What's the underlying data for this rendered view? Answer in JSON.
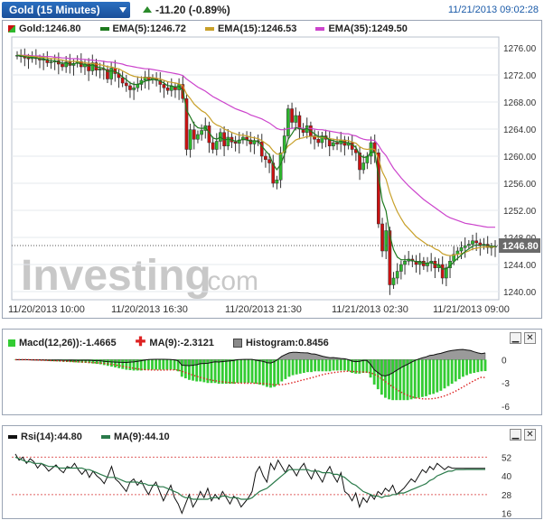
{
  "header": {
    "title": "Gold (15 Minutes)",
    "change": "-11.20 (-0.89%)",
    "timestamp": "11/21/2013 09:02:28"
  },
  "main_legend": {
    "gold": "Gold:1246.80",
    "ema5": "EMA(5):1246.72",
    "ema15": "EMA(15):1246.53",
    "ema35": "EMA(35):1249.50"
  },
  "macd_legend": {
    "macd": "Macd(12,26)):-1.4665",
    "ma9": "MA(9):-2.3121",
    "hist": "Histogram:0.8456"
  },
  "rsi_legend": {
    "rsi": "Rsi(14):44.80",
    "ma9": "MA(9):44.10"
  },
  "watermark": {
    "main": "Investing",
    "suffix": ".com"
  },
  "colors": {
    "candle_up": "#2eb82e",
    "candle_down": "#cc1111",
    "ema5": "#1e7a1e",
    "ema15": "#c8a02a",
    "ema35": "#cc44cc",
    "macd_hist": "#33cc33",
    "macd_line": "#111111",
    "macd_ma": "#dd2222",
    "rsi_line": "#111111",
    "rsi_ma": "#2a7a4a",
    "price_box": "#6a6a6a"
  },
  "chart_data": [
    {
      "type": "candlestick",
      "title": "Gold (15 Minutes)",
      "y_ticks": [
        "1276.00",
        "1272.00",
        "1268.00",
        "1264.00",
        "1260.00",
        "1256.00",
        "1252.00",
        "1248.00",
        "1244.00",
        "1240.00"
      ],
      "ylim": [
        1238.8,
        1277.6
      ],
      "x_ticks": [
        "11/20/2013 10:00",
        "11/20/2013 16:30",
        "11/20/2013 21:30",
        "11/21/2013 02:30",
        "11/21/2013 09:00"
      ],
      "last_price_label": "1246.80",
      "last_price": 1246.8,
      "close": [
        1274.9,
        1274.7,
        1274.5,
        1274.4,
        1274.6,
        1274.4,
        1274.2,
        1274.3,
        1273.8,
        1273.9,
        1274.1,
        1273.6,
        1273.2,
        1273.9,
        1273.4,
        1273.7,
        1274.0,
        1273.2,
        1273.6,
        1272.6,
        1273.8,
        1272.7,
        1272.9,
        1272.8,
        1271.4,
        1273.0,
        1272.2,
        1271.6,
        1270.8,
        1270.4,
        1269.8,
        1270.1,
        1270.6,
        1271.2,
        1271.7,
        1271.3,
        1271.5,
        1271.2,
        1270.6,
        1270.1,
        1269.7,
        1270.3,
        1269.8,
        1270.6,
        1268.5,
        1261.0,
        1263.9,
        1262.5,
        1263.2,
        1263.8,
        1264.5,
        1262.0,
        1261.0,
        1262.2,
        1263.5,
        1261.5,
        1262.8,
        1262.1,
        1261.9,
        1262.4,
        1262.8,
        1262.4,
        1261.8,
        1262.3,
        1262.1,
        1260.0,
        1259.5,
        1259.0,
        1256.0,
        1256.5,
        1260.5,
        1263.0,
        1267.0,
        1265.0,
        1266.0,
        1264.0,
        1263.5,
        1264.5,
        1263.0,
        1262.5,
        1262.0,
        1263.0,
        1262.5,
        1261.5,
        1262.0,
        1261.8,
        1262.4,
        1261.6,
        1262.0,
        1261.0,
        1260.5,
        1258.0,
        1259.0,
        1260.0,
        1262.0,
        1260.5,
        1250.0,
        1246.0,
        1249.0,
        1241.0,
        1242.0,
        1243.0,
        1244.0,
        1244.5,
        1244.8,
        1244.5,
        1244.0,
        1244.5,
        1243.8,
        1244.2,
        1244.5,
        1243.5,
        1244.0,
        1242.0,
        1243.5,
        1244.5,
        1245.5,
        1246.0,
        1246.5,
        1246.8,
        1247.0,
        1247.5,
        1247.2,
        1246.8,
        1247.0,
        1246.5,
        1246.6,
        1246.7
      ],
      "ema5": [
        1274.9,
        1274.8,
        1274.7,
        1274.6,
        1274.6,
        1274.5,
        1274.4,
        1274.4,
        1274.2,
        1274.1,
        1274.1,
        1273.9,
        1273.7,
        1273.8,
        1273.6,
        1273.6,
        1273.8,
        1273.6,
        1273.6,
        1273.3,
        1273.5,
        1273.2,
        1273.1,
        1273.0,
        1272.5,
        1272.6,
        1272.5,
        1272.2,
        1271.7,
        1271.3,
        1270.8,
        1270.6,
        1270.6,
        1270.8,
        1271.1,
        1271.2,
        1271.3,
        1271.3,
        1271.1,
        1270.8,
        1270.4,
        1270.4,
        1270.2,
        1270.3,
        1269.7,
        1266.8,
        1265.8,
        1264.7,
        1264.2,
        1264.1,
        1264.2,
        1263.5,
        1262.7,
        1262.5,
        1262.8,
        1262.4,
        1262.5,
        1262.4,
        1262.2,
        1262.3,
        1262.5,
        1262.4,
        1262.2,
        1262.3,
        1262.2,
        1261.5,
        1260.8,
        1260.2,
        1258.8,
        1258.0,
        1258.8,
        1260.2,
        1262.5,
        1263.3,
        1264.2,
        1264.1,
        1263.9,
        1264.1,
        1263.7,
        1263.3,
        1262.9,
        1262.9,
        1262.8,
        1262.4,
        1262.3,
        1262.1,
        1262.2,
        1262.0,
        1262.0,
        1261.7,
        1261.3,
        1260.2,
        1259.8,
        1259.9,
        1260.6,
        1260.6,
        1257.0,
        1253.4,
        1251.9,
        1248.3,
        1246.2,
        1245.1,
        1244.7,
        1244.7,
        1244.7,
        1244.6,
        1244.4,
        1244.4,
        1244.2,
        1244.2,
        1244.3,
        1244.0,
        1244.0,
        1243.3,
        1243.4,
        1243.8,
        1244.4,
        1244.9,
        1245.4,
        1245.9,
        1246.3,
        1246.7,
        1246.9,
        1246.8,
        1246.9,
        1246.8,
        1246.7,
        1246.7
      ],
      "ema15": [
        1274.9,
        1274.9,
        1274.8,
        1274.8,
        1274.7,
        1274.7,
        1274.6,
        1274.6,
        1274.5,
        1274.4,
        1274.4,
        1274.3,
        1274.2,
        1274.1,
        1274.0,
        1274.0,
        1274.0,
        1273.9,
        1273.8,
        1273.7,
        1273.7,
        1273.6,
        1273.5,
        1273.4,
        1273.2,
        1273.2,
        1273.0,
        1272.9,
        1272.6,
        1272.3,
        1272.0,
        1271.8,
        1271.7,
        1271.6,
        1271.6,
        1271.6,
        1271.6,
        1271.5,
        1271.4,
        1271.2,
        1271.0,
        1270.9,
        1270.8,
        1270.7,
        1270.4,
        1269.2,
        1268.5,
        1267.7,
        1267.2,
        1266.7,
        1266.4,
        1265.8,
        1265.0,
        1264.6,
        1264.4,
        1264.0,
        1263.8,
        1263.5,
        1263.3,
        1263.1,
        1263.1,
        1263.0,
        1262.8,
        1262.7,
        1262.6,
        1262.3,
        1261.9,
        1261.5,
        1260.8,
        1260.3,
        1260.3,
        1260.7,
        1261.5,
        1261.9,
        1262.4,
        1262.6,
        1262.7,
        1262.9,
        1262.9,
        1262.9,
        1262.8,
        1262.8,
        1262.7,
        1262.6,
        1262.5,
        1262.4,
        1262.4,
        1262.3,
        1262.3,
        1262.1,
        1261.9,
        1261.4,
        1261.1,
        1261.0,
        1261.1,
        1261.0,
        1259.6,
        1257.7,
        1256.6,
        1254.6,
        1253.1,
        1251.8,
        1250.8,
        1249.9,
        1249.3,
        1248.7,
        1248.1,
        1247.7,
        1247.3,
        1246.9,
        1246.7,
        1246.3,
        1246.1,
        1245.6,
        1245.4,
        1245.3,
        1245.4,
        1245.5,
        1245.6,
        1245.8,
        1246.0,
        1246.3,
        1246.4,
        1246.5,
        1246.6,
        1246.6,
        1246.6,
        1246.6
      ],
      "ema35": [
        1274.9,
        1274.9,
        1274.9,
        1274.9,
        1274.8,
        1274.8,
        1274.8,
        1274.7,
        1274.7,
        1274.7,
        1274.6,
        1274.6,
        1274.5,
        1274.5,
        1274.4,
        1274.4,
        1274.4,
        1274.3,
        1274.3,
        1274.2,
        1274.2,
        1274.1,
        1274.1,
        1274.0,
        1273.9,
        1273.9,
        1273.8,
        1273.7,
        1273.6,
        1273.4,
        1273.3,
        1273.2,
        1273.1,
        1273.0,
        1272.9,
        1272.9,
        1272.8,
        1272.7,
        1272.6,
        1272.5,
        1272.4,
        1272.3,
        1272.2,
        1272.1,
        1271.9,
        1271.4,
        1271.0,
        1270.6,
        1270.2,
        1269.9,
        1269.6,
        1269.2,
        1268.8,
        1268.5,
        1268.2,
        1267.9,
        1267.6,
        1267.3,
        1267.0,
        1266.8,
        1266.6,
        1266.4,
        1266.1,
        1265.9,
        1265.7,
        1265.5,
        1265.2,
        1264.9,
        1264.5,
        1264.1,
        1263.9,
        1263.9,
        1264.1,
        1264.1,
        1264.2,
        1264.2,
        1264.1,
        1264.1,
        1264.1,
        1264.0,
        1263.9,
        1263.9,
        1263.8,
        1263.7,
        1263.6,
        1263.5,
        1263.4,
        1263.3,
        1263.3,
        1263.1,
        1263.0,
        1262.7,
        1262.5,
        1262.4,
        1262.4,
        1262.3,
        1261.6,
        1260.7,
        1260.1,
        1259.1,
        1258.2,
        1257.5,
        1256.8,
        1256.2,
        1255.6,
        1255.1,
        1254.6,
        1254.1,
        1253.6,
        1253.2,
        1252.8,
        1252.4,
        1252.0,
        1251.6,
        1251.2,
        1250.9,
        1250.7,
        1250.5,
        1250.3,
        1250.1,
        1250.0,
        1249.9,
        1249.8,
        1249.7,
        1249.6,
        1249.5,
        1249.5,
        1249.5
      ]
    },
    {
      "type": "bar",
      "title": "Macd(12,26)",
      "y_ticks": [
        "0",
        "-3",
        "-6"
      ],
      "ylim": [
        -6.8,
        1.2
      ],
      "macd": [
        0.0,
        0.0,
        0.0,
        -0.02,
        -0.05,
        -0.08,
        -0.1,
        -0.12,
        -0.15,
        -0.18,
        -0.2,
        -0.22,
        -0.25,
        -0.28,
        -0.3,
        -0.32,
        -0.35,
        -0.38,
        -0.4,
        -0.42,
        -0.45,
        -0.5,
        -0.55,
        -0.6,
        -0.7,
        -0.8,
        -0.9,
        -1.0,
        -1.1,
        -1.2,
        -1.3,
        -1.35,
        -1.4,
        -1.4,
        -1.4,
        -1.35,
        -1.3,
        -1.3,
        -1.3,
        -1.3,
        -1.3,
        -1.3,
        -1.3,
        -1.35,
        -1.5,
        -2.2,
        -2.4,
        -2.6,
        -2.7,
        -2.8,
        -2.8,
        -2.9,
        -3.0,
        -3.0,
        -3.0,
        -3.1,
        -3.1,
        -3.1,
        -3.1,
        -3.1,
        -3.0,
        -3.0,
        -3.0,
        -3.0,
        -3.0,
        -3.1,
        -3.2,
        -3.3,
        -3.5,
        -3.6,
        -3.5,
        -3.2,
        -2.8,
        -2.5,
        -2.2,
        -2.0,
        -1.9,
        -1.8,
        -1.7,
        -1.6,
        -1.6,
        -1.5,
        -1.5,
        -1.5,
        -1.5,
        -1.5,
        -1.4,
        -1.4,
        -1.4,
        -1.4,
        -1.5,
        -1.7,
        -1.8,
        -1.8,
        -1.7,
        -1.7,
        -2.3,
        -3.2,
        -3.8,
        -4.5,
        -4.9,
        -5.1,
        -5.2,
        -5.2,
        -5.2,
        -5.2,
        -5.2,
        -5.1,
        -5.0,
        -4.9,
        -4.8,
        -4.7,
        -4.5,
        -4.4,
        -4.2,
        -4.0,
        -3.7,
        -3.4,
        -3.1,
        -2.8,
        -2.5,
        -2.2,
        -2.0,
        -1.8,
        -1.7,
        -1.6,
        -1.5,
        -1.47
      ],
      "ma9": [
        0.0,
        0.0,
        0.0,
        -0.01,
        -0.02,
        -0.03,
        -0.05,
        -0.07,
        -0.09,
        -0.11,
        -0.13,
        -0.15,
        -0.17,
        -0.19,
        -0.21,
        -0.24,
        -0.26,
        -0.28,
        -0.31,
        -0.33,
        -0.36,
        -0.38,
        -0.41,
        -0.45,
        -0.49,
        -0.54,
        -0.61,
        -0.68,
        -0.76,
        -0.85,
        -0.94,
        -1.03,
        -1.11,
        -1.19,
        -1.25,
        -1.29,
        -1.32,
        -1.33,
        -1.34,
        -1.34,
        -1.34,
        -1.33,
        -1.32,
        -1.32,
        -1.34,
        -1.49,
        -1.66,
        -1.83,
        -1.99,
        -2.15,
        -2.28,
        -2.41,
        -2.53,
        -2.64,
        -2.72,
        -2.79,
        -2.85,
        -2.9,
        -2.94,
        -2.98,
        -3.0,
        -3.02,
        -3.03,
        -3.03,
        -3.03,
        -3.03,
        -3.05,
        -3.07,
        -3.11,
        -3.17,
        -3.23,
        -3.25,
        -3.22,
        -3.16,
        -3.06,
        -2.95,
        -2.83,
        -2.7,
        -2.58,
        -2.46,
        -2.34,
        -2.21,
        -2.07,
        -1.94,
        -1.83,
        -1.74,
        -1.66,
        -1.6,
        -1.55,
        -1.51,
        -1.49,
        -1.51,
        -1.54,
        -1.57,
        -1.59,
        -1.6,
        -1.69,
        -1.88,
        -2.14,
        -2.46,
        -2.81,
        -3.16,
        -3.5,
        -3.82,
        -4.11,
        -4.37,
        -4.59,
        -4.76,
        -4.89,
        -4.97,
        -5.03,
        -5.05,
        -5.04,
        -5.0,
        -4.92,
        -4.81,
        -4.66,
        -4.48,
        -4.27,
        -4.04,
        -3.78,
        -3.51,
        -3.23,
        -2.96,
        -2.7,
        -2.46,
        -2.26,
        -2.31
      ],
      "histogram": [
        0.0,
        0.0,
        0.0,
        -0.01,
        -0.03,
        -0.05,
        -0.05,
        -0.05,
        -0.06,
        -0.07,
        -0.07,
        -0.07,
        -0.08,
        -0.09,
        -0.09,
        -0.08,
        -0.09,
        -0.1,
        -0.09,
        -0.09,
        -0.09,
        -0.12,
        -0.14,
        -0.15,
        -0.21,
        -0.26,
        -0.29,
        -0.32,
        -0.34,
        -0.35,
        -0.36,
        -0.32,
        -0.29,
        -0.21,
        -0.15,
        -0.06,
        0.02,
        0.03,
        0.04,
        0.04,
        0.04,
        0.03,
        0.02,
        -0.03,
        -0.16,
        -0.71,
        -0.74,
        -0.77,
        -0.71,
        -0.65,
        -0.52,
        -0.49,
        -0.47,
        -0.36,
        -0.28,
        -0.31,
        -0.25,
        -0.2,
        -0.16,
        -0.12,
        0.0,
        0.02,
        0.03,
        0.03,
        0.03,
        -0.07,
        -0.15,
        -0.23,
        -0.39,
        -0.43,
        -0.27,
        0.05,
        0.42,
        0.66,
        0.86,
        0.95,
        0.93,
        0.9,
        0.88,
        0.86,
        0.74,
        0.71,
        0.57,
        0.44,
        0.33,
        0.24,
        0.26,
        0.2,
        0.15,
        0.11,
        -0.01,
        -0.19,
        -0.26,
        -0.23,
        -0.11,
        -0.1,
        -0.61,
        -1.32,
        -1.66,
        -2.04,
        -2.09,
        -1.94,
        -1.7,
        -1.38,
        -1.09,
        -0.83,
        -0.61,
        -0.34,
        -0.11,
        0.07,
        0.23,
        0.35,
        0.54,
        0.6,
        0.72,
        0.81,
        0.96,
        1.08,
        1.17,
        1.24,
        1.28,
        1.31,
        1.23,
        1.16,
        1.0,
        0.86,
        0.76,
        0.85
      ]
    },
    {
      "type": "line",
      "title": "Rsi(14)",
      "y_ticks": [
        "52",
        "40",
        "28",
        "16"
      ],
      "ylim": [
        14,
        58
      ],
      "rsi": [
        54,
        50,
        52,
        48,
        51,
        49,
        45,
        48,
        46,
        43,
        45,
        47,
        44,
        42,
        46,
        45,
        48,
        44,
        41,
        44,
        39,
        43,
        40,
        38,
        35,
        40,
        46,
        38,
        36,
        33,
        30,
        36,
        38,
        34,
        37,
        32,
        28,
        33,
        36,
        30,
        24,
        29,
        34,
        26,
        22,
        16,
        22,
        28,
        20,
        24,
        30,
        26,
        32,
        24,
        28,
        25,
        30,
        26,
        22,
        27,
        25,
        20,
        23,
        26,
        30,
        42,
        46,
        40,
        36,
        48,
        44,
        50,
        46,
        42,
        47,
        44,
        40,
        45,
        48,
        42,
        38,
        44,
        40,
        36,
        42,
        46,
        40,
        36,
        42,
        30,
        28,
        24,
        29,
        20,
        26,
        23,
        28,
        25,
        30,
        28,
        32,
        30,
        34,
        28,
        30,
        32,
        35,
        38,
        36,
        40,
        44,
        42,
        46,
        44,
        48,
        46,
        44,
        46,
        45,
        44.8,
        44.8,
        44.8,
        44.8,
        44.8,
        44.8,
        44.8,
        44.8,
        44.8
      ],
      "ma9": [
        52,
        51,
        50,
        49,
        49,
        48,
        48,
        48,
        47,
        46,
        46,
        46,
        45,
        45,
        45,
        45,
        45,
        45,
        45,
        44,
        44,
        43,
        42,
        41,
        40,
        39,
        39,
        39,
        38,
        37,
        36,
        36,
        36,
        36,
        35,
        35,
        34,
        34,
        34,
        33,
        33,
        32,
        31,
        30,
        29,
        27,
        26,
        26,
        25,
        25,
        25,
        25,
        25,
        26,
        26,
        26,
        27,
        27,
        26,
        26,
        26,
        25,
        25,
        25,
        26,
        28,
        30,
        31,
        32,
        34,
        36,
        38,
        40,
        42,
        44,
        44,
        44,
        44,
        44,
        44,
        43,
        43,
        43,
        42,
        42,
        42,
        41,
        41,
        40,
        39,
        37,
        35,
        34,
        32,
        30,
        29,
        28,
        27,
        27,
        26,
        27,
        27,
        28,
        28,
        29,
        29,
        30,
        31,
        32,
        33,
        34,
        35,
        37,
        38,
        40,
        41,
        42,
        43,
        43,
        44,
        44,
        44,
        44.1,
        44.1,
        44.1,
        44.1,
        44.1,
        44.1
      ]
    }
  ]
}
